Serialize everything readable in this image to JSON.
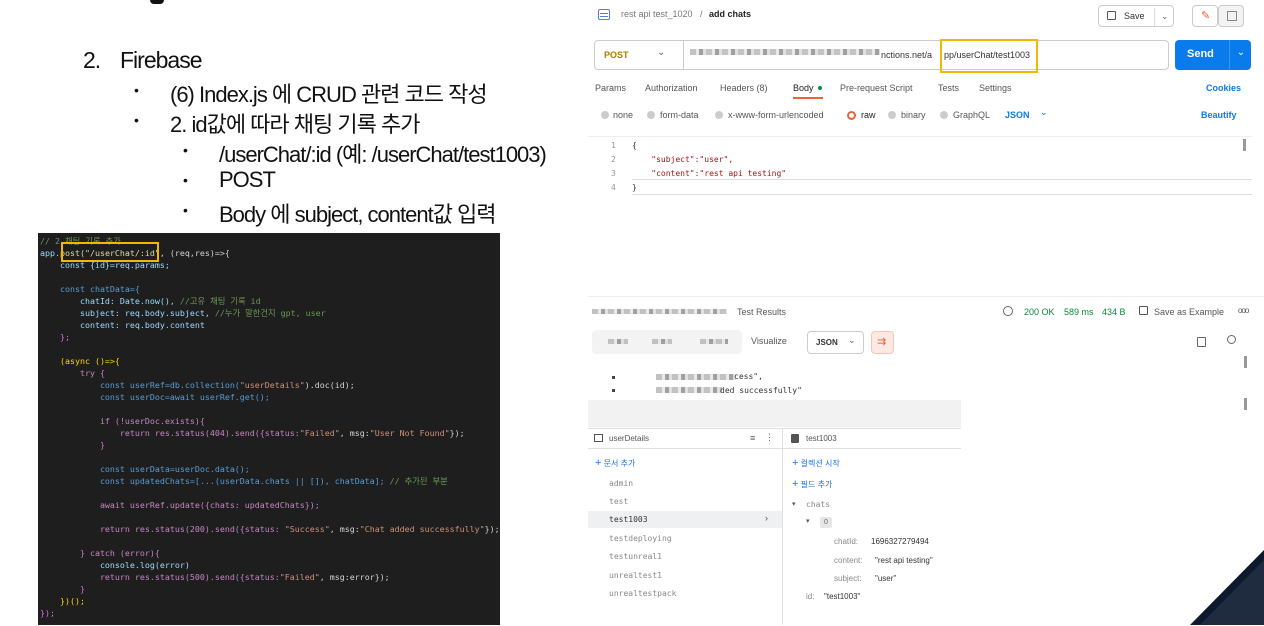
{
  "slide": {
    "heading_number": "2.",
    "heading_text": "Firebase",
    "bullet1": "(6) Index.js 에 CRUD 관련 코드 작성",
    "bullet2": "2. id값에 따라 채팅 기록 추가",
    "sub1": "/userChat/:id (예: /userChat/test1003)",
    "sub2": "POST",
    "sub3": "Body 에 subject, content값 입력"
  },
  "code": {
    "line1_comment": "// 2.채팅 기록 추가",
    "line2_a": "app.",
    "line2_b": "post(\"/userChat/:id\"",
    "line2_c": ", (req,res)=>{",
    "line3": "    const {id}=req.params;",
    "line5": "    const chatData={",
    "line6_a": "        chatId: Date.now(), ",
    "line6_c": "//고유 채팅 기록 id",
    "line7_a": "        subject: req.body.subject, ",
    "line7_c": "//누가 말한건지 gpt, user",
    "line8": "        content: req.body.content",
    "line9": "    };",
    "line11": "    (async ()=>{",
    "line12": "        try {",
    "line13_a": "            const userRef=db.collection(",
    "line13_s": "\"userDetails\"",
    "line13_b": ").doc(id);",
    "line14": "            const userDoc=await userRef.get();",
    "line16": "            if (!userDoc.exists){",
    "line17_a": "                return res.status(404).send({status:",
    "line17_s1": "\"Failed\"",
    "line17_b": ", msg:",
    "line17_s2": "\"User Not Found\"",
    "line17_c": "});",
    "line18": "            }",
    "line20": "            const userData=userDoc.data();",
    "line21_a": "            const updatedChats=[...(userData.chats || []), chatData]; ",
    "line21_c": "// 추가된 부분",
    "line23": "            await userRef.update({chats: updatedChats});",
    "line25_a": "            return res.status(200).send({status: ",
    "line25_s1": "\"Success\"",
    "line25_b": ", msg:",
    "line25_s2": "\"Chat added successfully\"",
    "line25_c": "});",
    "line27": "        } catch (error){",
    "line28": "            console.log(error)",
    "line29_a": "            return res.status(500).send({status:",
    "line29_s": "\"Failed\"",
    "line29_b": ", msg:error});",
    "line30": "        }",
    "line31": "    })();",
    "line32": "});"
  },
  "postman": {
    "breadcrumb_collection": "rest api test_1020",
    "breadcrumb_sep": "/",
    "breadcrumb_request": "add chats",
    "save_label": "Save",
    "method": "POST",
    "url_visible_tail": "nctions.net/a",
    "url_highlight": "pp/userChat/test1003",
    "send_label": "Send",
    "tabs": [
      "Params",
      "Authorization",
      "Headers (8)",
      "Body",
      "Pre-request Script",
      "Tests",
      "Settings"
    ],
    "active_tab": "Body",
    "cookies_label": "Cookies",
    "body_types": [
      "none",
      "form-data",
      "x-www-form-urlencoded",
      "raw",
      "binary",
      "GraphQL"
    ],
    "body_type_selected": "raw",
    "format": "JSON",
    "beautify_label": "Beautify",
    "body_lines": [
      {
        "num": "1",
        "text": "{"
      },
      {
        "num": "2",
        "text": "    \"subject\":\"user\","
      },
      {
        "num": "3",
        "text": "    \"content\":\"rest api testing\""
      },
      {
        "num": "4",
        "text": "}"
      }
    ],
    "test_results_label": "Test Results",
    "status": "200 OK",
    "time": "589 ms",
    "size": "434 B",
    "save_example_label": "Save as Example",
    "more_label": "ooo",
    "visualize_label": "Visualize",
    "response_format": "JSON",
    "response_line1": "cess\",",
    "response_line2": "ded successfully\""
  },
  "firebase": {
    "collection_name": "userDetails",
    "add_document": "문서 추가",
    "documents": [
      "admin",
      "test",
      "test1003",
      "testdeploying",
      "testunreal1",
      "unrealtest1",
      "unrealtestpack"
    ],
    "selected_document": "test1003",
    "doc_title": "test1003",
    "start_collection": "컬렉션 시작",
    "add_field": "필드 추가",
    "field_chats": "chats",
    "index_0": "0",
    "chatId_key": "chatId:",
    "chatId_val": "1696327279494",
    "content_key": "content:",
    "content_val": "\"rest api testing\"",
    "subject_key": "subject:",
    "subject_val": "\"user\"",
    "id_key": "id:",
    "id_val": "\"test1003\""
  },
  "colors": {
    "highlight": "#f2b705",
    "send_blue": "#097bed",
    "code_bg": "#1e1e1e",
    "status_green": "#0a8a3a"
  }
}
